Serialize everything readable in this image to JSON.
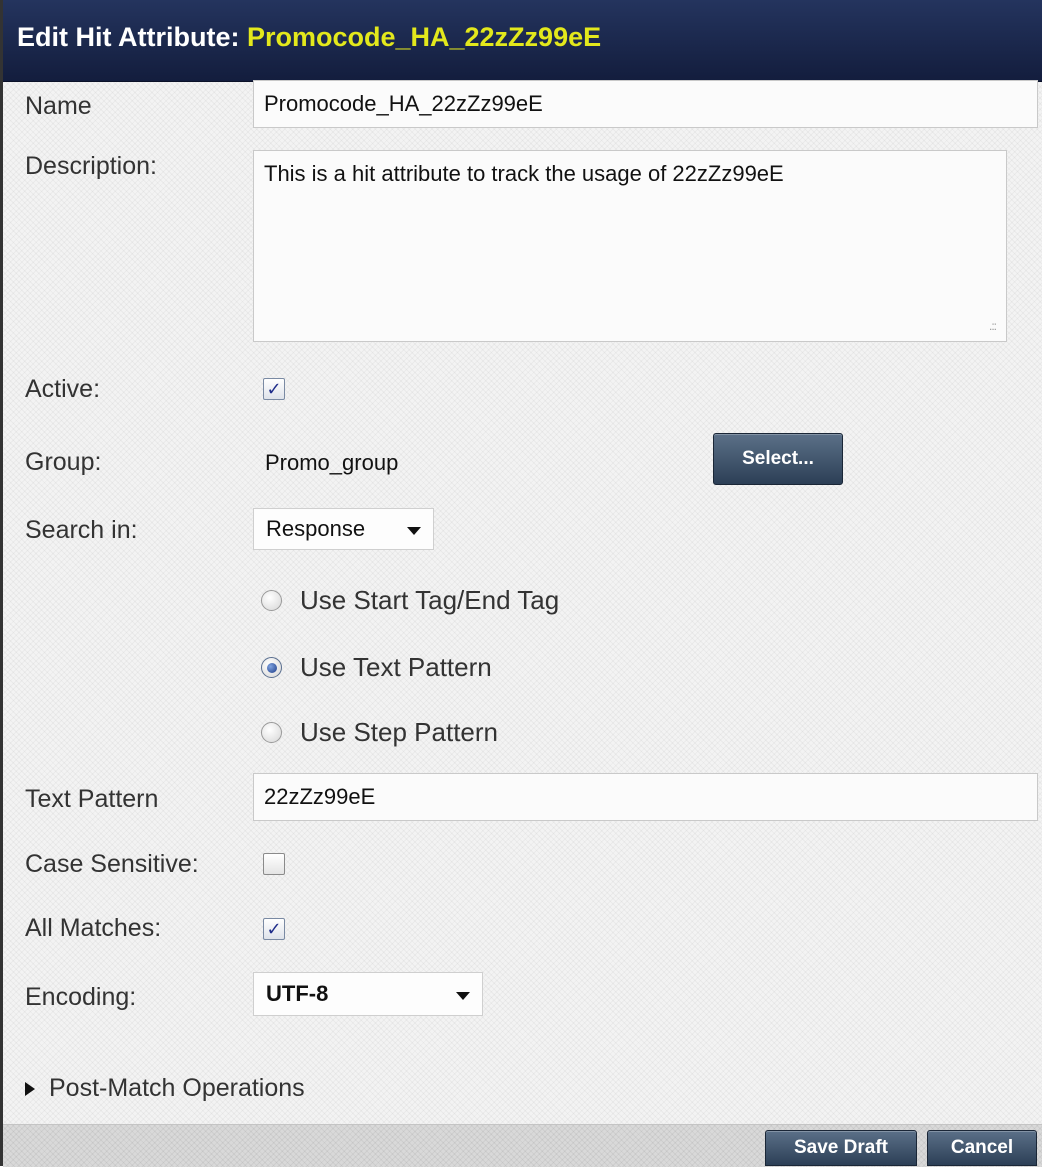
{
  "dialog": {
    "title_prefix": "Edit Hit Attribute: ",
    "title_name": "Promocode_HA_22zZz99eE"
  },
  "form": {
    "name_label": "Name",
    "name_value": "Promocode_HA_22zZz99eE",
    "description_label": "Description:",
    "description_value": "This is a hit attribute to track the usage of 22zZz99eE",
    "active_label": "Active:",
    "active_checked": true,
    "group_label": "Group:",
    "group_value": "Promo_group",
    "select_button": "Select...",
    "search_in_label": "Search in:",
    "search_in_value": "Response",
    "radio_options": [
      {
        "label": "Use Start Tag/End Tag",
        "selected": false
      },
      {
        "label": "Use Text Pattern",
        "selected": true
      },
      {
        "label": "Use Step Pattern",
        "selected": false
      }
    ],
    "text_pattern_label": "Text Pattern",
    "text_pattern_value": "22zZz99eE",
    "case_sensitive_label": "Case Sensitive:",
    "case_sensitive_checked": false,
    "all_matches_label": "All Matches:",
    "all_matches_checked": true,
    "encoding_label": "Encoding:",
    "encoding_value": "UTF-8",
    "post_match_label": "Post-Match Operations"
  },
  "footer": {
    "save_draft": "Save Draft",
    "cancel": "Cancel"
  },
  "colors": {
    "title_bar": "#1b2a52",
    "title_highlight": "#e3e81c",
    "button": "#3e536b"
  }
}
